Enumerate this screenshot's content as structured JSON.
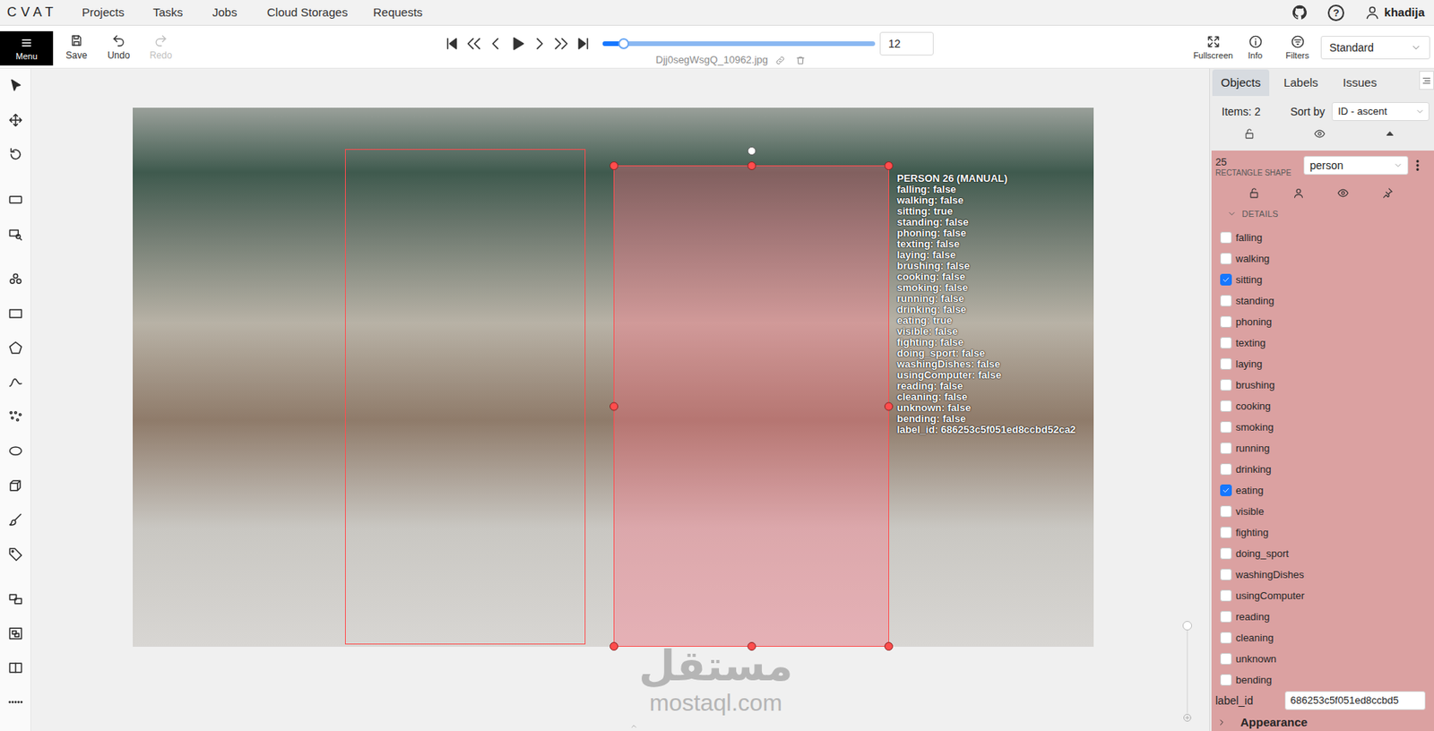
{
  "nav": {
    "logo": "CVAT",
    "items": [
      "Projects",
      "Tasks",
      "Jobs",
      "Cloud Storages",
      "Requests"
    ],
    "help_icon": "?",
    "user": "khadija"
  },
  "toolbar": {
    "menu": "Menu",
    "save": "Save",
    "undo": "Undo",
    "redo": {
      "label": "Redo",
      "disabled": true
    },
    "player": {
      "level": 0.077,
      "frame": "12",
      "filename": "Djj0segWsgQ_10962.jpg"
    },
    "actions": [
      "Fullscreen",
      "Info",
      "Filters"
    ],
    "workspace": "Standard"
  },
  "canvas": {
    "shapes": [
      {
        "selected": false
      },
      {
        "selected": true
      }
    ],
    "overlay": {
      "title": "PERSON 26 (MANUAL)",
      "lines": [
        "falling: false",
        "walking: false",
        "sitting: true",
        "standing: false",
        "phoning: false",
        "texting: false",
        "laying: false",
        "brushing: false",
        "cooking: false",
        "smoking: false",
        "running: false",
        "drinking: false",
        "eating: true",
        "visible: false",
        "fighting: false",
        "doing_sport: false",
        "washingDishes: false",
        "usingComputer: false",
        "reading: false",
        "cleaning: false",
        "unknown: false",
        "bending: false",
        "label_id: 686253c5f051ed8ccbd52ca2"
      ]
    },
    "zoom": {
      "level": 1
    },
    "watermark": {
      "arabic": "مستقل",
      "latin": "mostaql.com"
    }
  },
  "panel": {
    "tabs": [
      {
        "label": "Objects",
        "selected": true
      },
      {
        "label": "Labels",
        "selected": false
      },
      {
        "label": "Issues",
        "selected": false
      }
    ],
    "items": "Items: 2",
    "sort_label": "Sort by",
    "sort_value": "ID - ascent",
    "object": {
      "id": "25",
      "type": "RECTANGLE SHAPE",
      "label": "person",
      "details": "DETAILS",
      "attributes": [
        {
          "name": "falling",
          "checked": false
        },
        {
          "name": "walking",
          "checked": false
        },
        {
          "name": "sitting",
          "checked": true
        },
        {
          "name": "standing",
          "checked": false
        },
        {
          "name": "phoning",
          "checked": false
        },
        {
          "name": "texting",
          "checked": false
        },
        {
          "name": "laying",
          "checked": false
        },
        {
          "name": "brushing",
          "checked": false
        },
        {
          "name": "cooking",
          "checked": false
        },
        {
          "name": "smoking",
          "checked": false
        },
        {
          "name": "running",
          "checked": false
        },
        {
          "name": "drinking",
          "checked": false
        },
        {
          "name": "eating",
          "checked": true
        },
        {
          "name": "visible",
          "checked": false
        },
        {
          "name": "fighting",
          "checked": false
        },
        {
          "name": "doing_sport",
          "checked": false
        },
        {
          "name": "washingDishes",
          "checked": false
        },
        {
          "name": "usingComputer",
          "checked": false
        },
        {
          "name": "reading",
          "checked": false
        },
        {
          "name": "cleaning",
          "checked": false
        },
        {
          "name": "unknown",
          "checked": false
        },
        {
          "name": "bending",
          "checked": false
        }
      ],
      "label_id": {
        "name": "label_id",
        "value": "686253c5f051ed8ccbd5"
      }
    },
    "appearance": "Appearance"
  }
}
